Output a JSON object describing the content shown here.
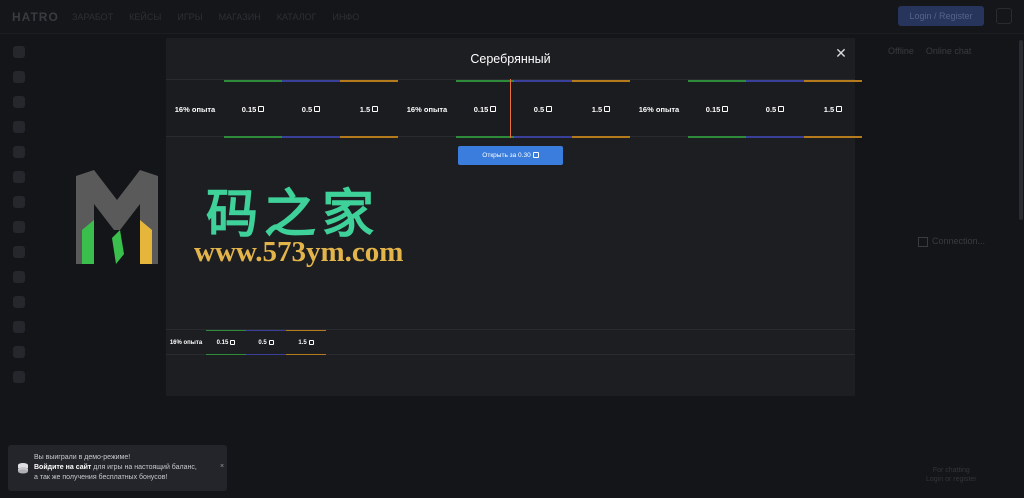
{
  "background": {
    "logo": "HATRO",
    "nav": [
      "ЗАРАБОТ",
      "КЕЙСЫ",
      "ИГРЫ",
      "МАГАЗИН",
      "КАТАЛОГ",
      "ИНФО"
    ],
    "login_label": "Login / Register",
    "chat_tabs": [
      "Offline",
      "Online chat"
    ],
    "connection_label": "Connection...",
    "chat_note": [
      "For chatting",
      "Login or register"
    ]
  },
  "modal": {
    "title": "Серебрянный",
    "roulette": [
      {
        "label": "16% опыта",
        "color": "none",
        "coin": false
      },
      {
        "label": "0.15",
        "color": "#2e8b3a",
        "coin": true
      },
      {
        "label": "0.5",
        "color": "#3a3f9a",
        "coin": true
      },
      {
        "label": "1.5",
        "color": "#b57a1c",
        "coin": true
      },
      {
        "label": "16% опыта",
        "color": "none",
        "coin": false
      },
      {
        "label": "0.15",
        "color": "#2e8b3a",
        "coin": true
      },
      {
        "label": "0.5",
        "color": "#3a3f9a",
        "coin": true
      },
      {
        "label": "1.5",
        "color": "#b57a1c",
        "coin": true
      },
      {
        "label": "16% опыта",
        "color": "none",
        "coin": false
      },
      {
        "label": "0.15",
        "color": "#2e8b3a",
        "coin": true
      },
      {
        "label": "0.5",
        "color": "#3a3f9a",
        "coin": true
      },
      {
        "label": "1.5",
        "color": "#b57a1c",
        "coin": true
      }
    ],
    "open_button": "Открыть за 0.30",
    "drops": [
      {
        "label": "16% опыта",
        "color": "none",
        "coin": false
      },
      {
        "label": "0.15",
        "color": "#2e8b3a",
        "coin": true
      },
      {
        "label": "0.5",
        "color": "#3a3f9a",
        "coin": true
      },
      {
        "label": "1.5",
        "color": "#b57a1c",
        "coin": true
      }
    ]
  },
  "watermark": {
    "cn_text": "码之家",
    "url": "www.573ym.com"
  },
  "toast": {
    "line1": "Вы выиграли в демо-режиме!",
    "line2_bold": "Войдите на сайт",
    "line2_rest": " для игры на настоящий баланс,",
    "line3": "а так же получения бесплатных бонусов!",
    "close": "×"
  },
  "colors": {
    "accent": "#3b7ddd",
    "pointer": "#e8703a",
    "green": "#2e8b3a",
    "blue": "#3a3f9a",
    "gold": "#b57a1c"
  }
}
